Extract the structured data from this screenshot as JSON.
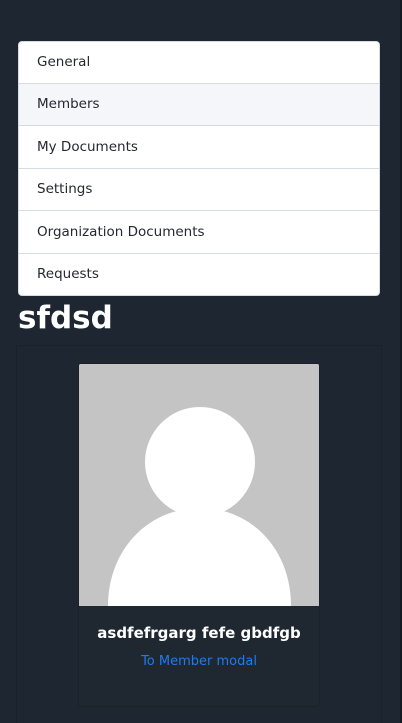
{
  "nav": {
    "items": [
      {
        "label": "General"
      },
      {
        "label": "Members"
      },
      {
        "label": "My Documents"
      },
      {
        "label": "Settings"
      },
      {
        "label": "Organization Documents"
      },
      {
        "label": "Requests"
      }
    ],
    "active": "Members"
  },
  "organization": {
    "name": "sfdsd"
  },
  "member_card": {
    "name": "asdfefrgarg fefe gbdfgb",
    "link_label": "To Member modal",
    "avatar_icon": "default-user-avatar-icon",
    "link_color": "#1f7bf2"
  },
  "colors": {
    "background": "#1e2731",
    "avatar_background": "#c4c4c4"
  }
}
